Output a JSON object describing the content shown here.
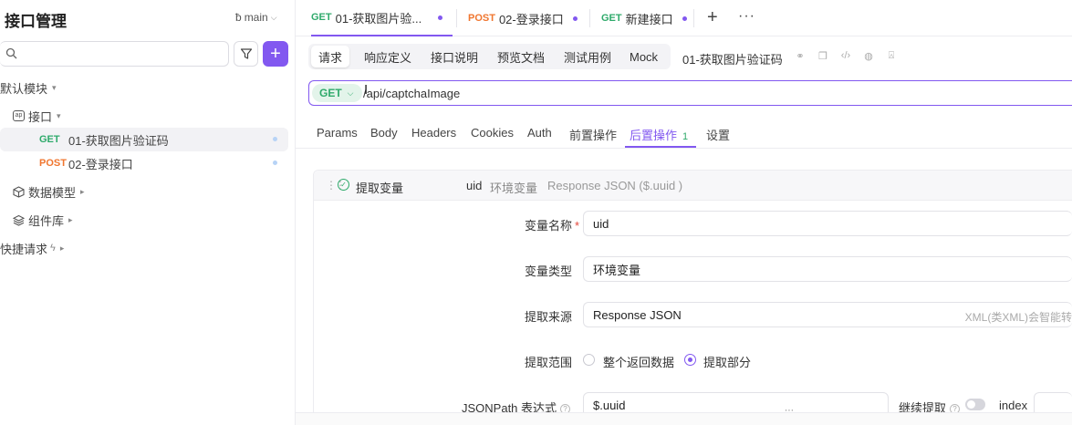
{
  "sidebar": {
    "title": "接口管理",
    "branch": "main",
    "search_placeholder": "",
    "add_label": "+",
    "default_module": "默认模块",
    "api_folder": "接口",
    "items": [
      {
        "method": "GET",
        "name": "01-获取图片验证码"
      },
      {
        "method": "POST",
        "name": "02-登录接口"
      }
    ],
    "data_model": "数据模型",
    "components": "组件库",
    "quick_request": "快捷请求"
  },
  "tabs": [
    {
      "method": "GET",
      "title": "01-获取图片验..."
    },
    {
      "method": "POST",
      "title": "02-登录接口"
    },
    {
      "method": "GET",
      "title": "新建接口"
    }
  ],
  "tab_actions": {
    "add": "+",
    "more": "···"
  },
  "subtabs": [
    "请求",
    "响应定义",
    "接口说明",
    "预览文档",
    "测试用例",
    "Mock"
  ],
  "api_name": "01-获取图片验证码",
  "url": {
    "method": "GET",
    "path": "/api/captchaImage"
  },
  "param_tabs": [
    "Params",
    "Body",
    "Headers",
    "Cookies",
    "Auth",
    "前置操作",
    "后置操作",
    "设置"
  ],
  "post_ops_count": "1",
  "extract": {
    "title": "提取变量",
    "var": "uid",
    "type": "环境变量",
    "source": "Response JSON ($.uuid )",
    "labels": {
      "var_name": "变量名称",
      "required": "*",
      "var_type": "变量类型",
      "source": "提取来源",
      "scope": "提取范围",
      "jsonpath": "JSONPath 表达式",
      "continue": "继续提取",
      "index": "index"
    },
    "values": {
      "var_name": "uid",
      "var_type": "环境变量",
      "source": "Response JSON",
      "source_hint": "XML(类XML)会智能转",
      "jsonpath": "$.uuid"
    },
    "scope_options": [
      "整个返回数据",
      "提取部分"
    ],
    "scope_selected": 1
  },
  "colors": {
    "accent": "#8258f0",
    "get": "#2faa6b",
    "post": "#f0762f"
  }
}
